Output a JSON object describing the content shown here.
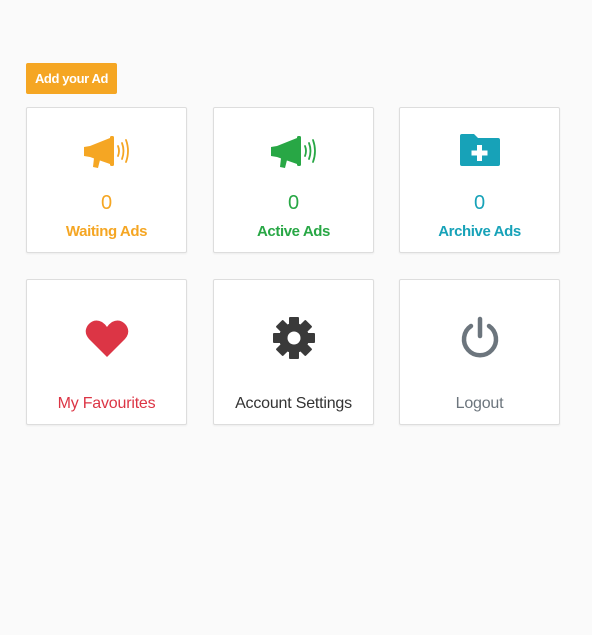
{
  "add_button": {
    "label": "Add your Ad"
  },
  "colors": {
    "orange": "#f5a623",
    "green": "#28a745",
    "teal": "#17a2b8",
    "red": "#dc3545",
    "dark": "#3a3a3a",
    "grey": "#6c757d"
  },
  "cards": {
    "waiting": {
      "icon": "megaphone-icon",
      "count": "0",
      "label": "Waiting Ads"
    },
    "active": {
      "icon": "megaphone-icon",
      "count": "0",
      "label": "Active Ads"
    },
    "archive": {
      "icon": "folder-plus-icon",
      "count": "0",
      "label": "Archive Ads"
    },
    "favourites": {
      "icon": "heart-icon",
      "label": "My Favourites"
    },
    "settings": {
      "icon": "gear-icon",
      "label": "Account Settings"
    },
    "logout": {
      "icon": "power-icon",
      "label": "Logout"
    }
  }
}
